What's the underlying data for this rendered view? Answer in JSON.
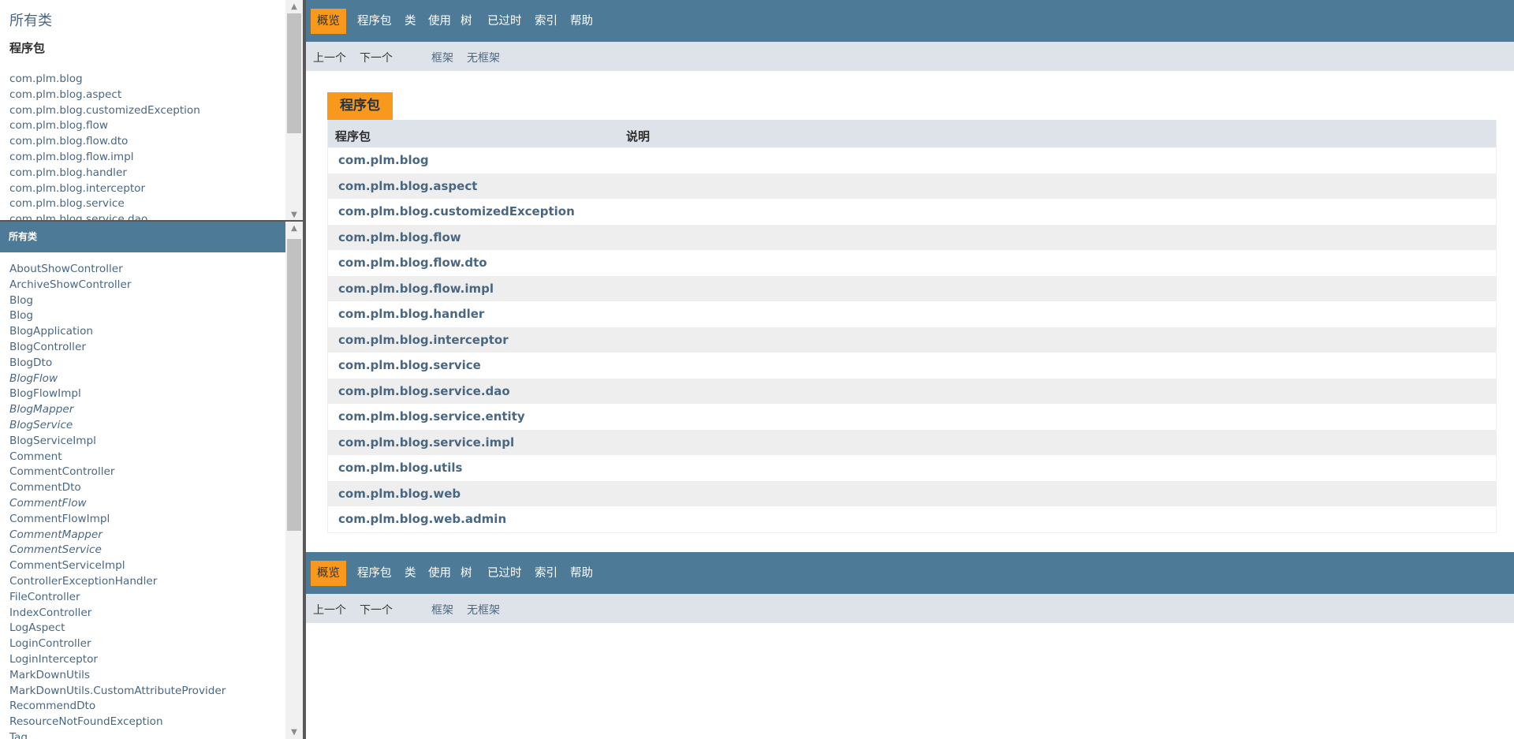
{
  "package_frame": {
    "title": "所有类",
    "subtitle": "程序包",
    "packages": [
      "com.plm.blog",
      "com.plm.blog.aspect",
      "com.plm.blog.customizedException",
      "com.plm.blog.flow",
      "com.plm.blog.flow.dto",
      "com.plm.blog.flow.impl",
      "com.plm.blog.handler",
      "com.plm.blog.interceptor",
      "com.plm.blog.service",
      "com.plm.blog.service.dao"
    ]
  },
  "class_frame": {
    "title": "所有类",
    "classes": [
      {
        "name": "AboutShowController",
        "interface": false
      },
      {
        "name": "ArchiveShowController",
        "interface": false
      },
      {
        "name": "Blog",
        "interface": false
      },
      {
        "name": "Blog",
        "interface": false
      },
      {
        "name": "BlogApplication",
        "interface": false
      },
      {
        "name": "BlogController",
        "interface": false
      },
      {
        "name": "BlogDto",
        "interface": false
      },
      {
        "name": "BlogFlow",
        "interface": true
      },
      {
        "name": "BlogFlowImpl",
        "interface": false
      },
      {
        "name": "BlogMapper",
        "interface": true
      },
      {
        "name": "BlogService",
        "interface": true
      },
      {
        "name": "BlogServiceImpl",
        "interface": false
      },
      {
        "name": "Comment",
        "interface": false
      },
      {
        "name": "CommentController",
        "interface": false
      },
      {
        "name": "CommentDto",
        "interface": false
      },
      {
        "name": "CommentFlow",
        "interface": true
      },
      {
        "name": "CommentFlowImpl",
        "interface": false
      },
      {
        "name": "CommentMapper",
        "interface": true
      },
      {
        "name": "CommentService",
        "interface": true
      },
      {
        "name": "CommentServiceImpl",
        "interface": false
      },
      {
        "name": "ControllerExceptionHandler",
        "interface": false
      },
      {
        "name": "FileController",
        "interface": false
      },
      {
        "name": "IndexController",
        "interface": false
      },
      {
        "name": "LogAspect",
        "interface": false
      },
      {
        "name": "LoginController",
        "interface": false
      },
      {
        "name": "LoginInterceptor",
        "interface": false
      },
      {
        "name": "MarkDownUtils",
        "interface": false
      },
      {
        "name": "MarkDownUtils.CustomAttributeProvider",
        "interface": false
      },
      {
        "name": "RecommendDto",
        "interface": false
      },
      {
        "name": "ResourceNotFoundException",
        "interface": false
      },
      {
        "name": "Tag",
        "interface": false
      }
    ]
  },
  "topnav": {
    "items": [
      "概览",
      "程序包",
      "类",
      "使用",
      "树",
      "已过时",
      "索引",
      "帮助"
    ],
    "active": "概览"
  },
  "subnav": {
    "prev": "上一个",
    "next": "下一个",
    "frames": "框架",
    "noframes": "无框架"
  },
  "overview": {
    "caption": "程序包",
    "col_package": "程序包",
    "col_desc": "说明",
    "packages": [
      "com.plm.blog",
      "com.plm.blog.aspect",
      "com.plm.blog.customizedException",
      "com.plm.blog.flow",
      "com.plm.blog.flow.dto",
      "com.plm.blog.flow.impl",
      "com.plm.blog.handler",
      "com.plm.blog.interceptor",
      "com.plm.blog.service",
      "com.plm.blog.service.dao",
      "com.plm.blog.service.entity",
      "com.plm.blog.service.impl",
      "com.plm.blog.utils",
      "com.plm.blog.web",
      "com.plm.blog.web.admin"
    ]
  },
  "colors": {
    "nav_bg": "#4d7a97",
    "accent": "#f8981d",
    "subnav_bg": "#dee3e9",
    "link": "#4a6782"
  }
}
